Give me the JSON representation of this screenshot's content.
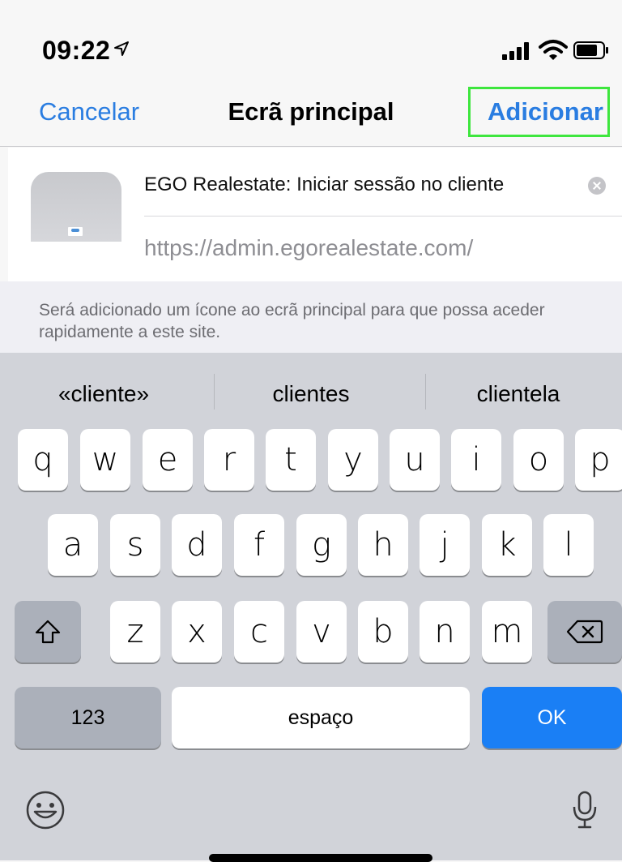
{
  "status": {
    "time": "09:22",
    "icons": [
      "location-arrow-icon",
      "signal-icon",
      "wifi-icon",
      "battery-icon"
    ]
  },
  "nav": {
    "cancel_label": "Cancelar",
    "title": "Ecrã principal",
    "add_label": "Adicionar",
    "highlight_color": "#3ee63e"
  },
  "card": {
    "name_value": "EGO Realestate: Iniciar sessão no cliente",
    "url_value": "https://admin.egorealestate.com/",
    "hint": "Será adicionado um ícone ao ecrã principal para que possa aceder rapidamente a este site."
  },
  "keyboard": {
    "suggestions": [
      "«cliente»",
      "clientes",
      "clientela"
    ],
    "row1": [
      "q",
      "w",
      "e",
      "r",
      "t",
      "y",
      "u",
      "i",
      "o",
      "p"
    ],
    "row2": [
      "a",
      "s",
      "d",
      "f",
      "g",
      "h",
      "j",
      "k",
      "l"
    ],
    "row3": [
      "z",
      "x",
      "c",
      "v",
      "b",
      "n",
      "m"
    ],
    "numbers_label": "123",
    "space_label": "espaço",
    "return_label": "OK",
    "accent_color": "#1a7ff5"
  }
}
